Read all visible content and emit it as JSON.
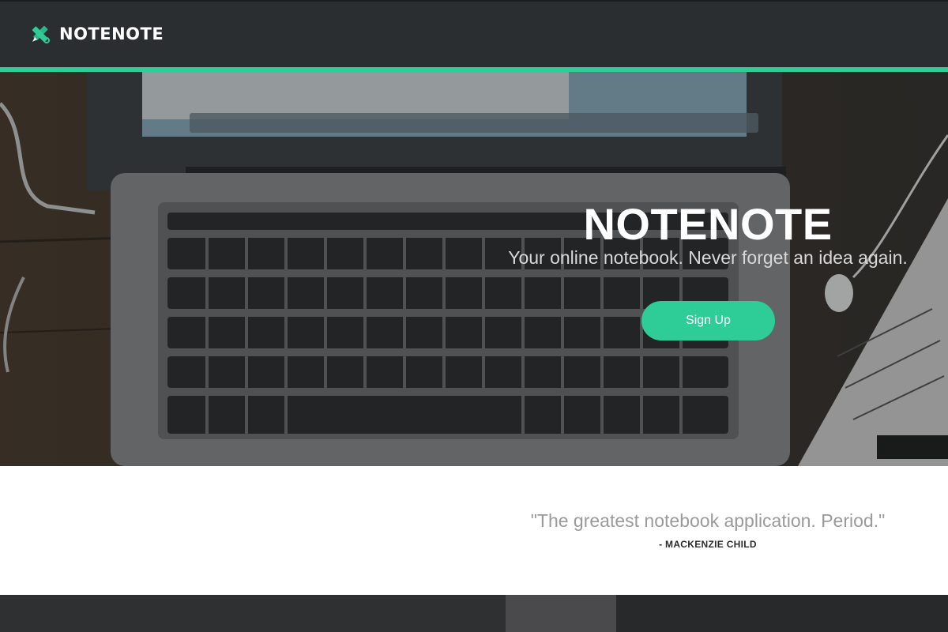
{
  "header": {
    "brand": "NOTENOTE",
    "logo_icon": "pencil-ruler-icon",
    "accent_color": "#2ecc96",
    "background_color": "#2b2e30"
  },
  "hero": {
    "title": "NOTENOTE",
    "subtitle": "Your online notebook. Never forget an idea again.",
    "signup_label": "Sign Up"
  },
  "testimonial": {
    "quote": "\"The greatest notebook application. Period.\"",
    "author": "- MACKENZIE CHILD"
  }
}
